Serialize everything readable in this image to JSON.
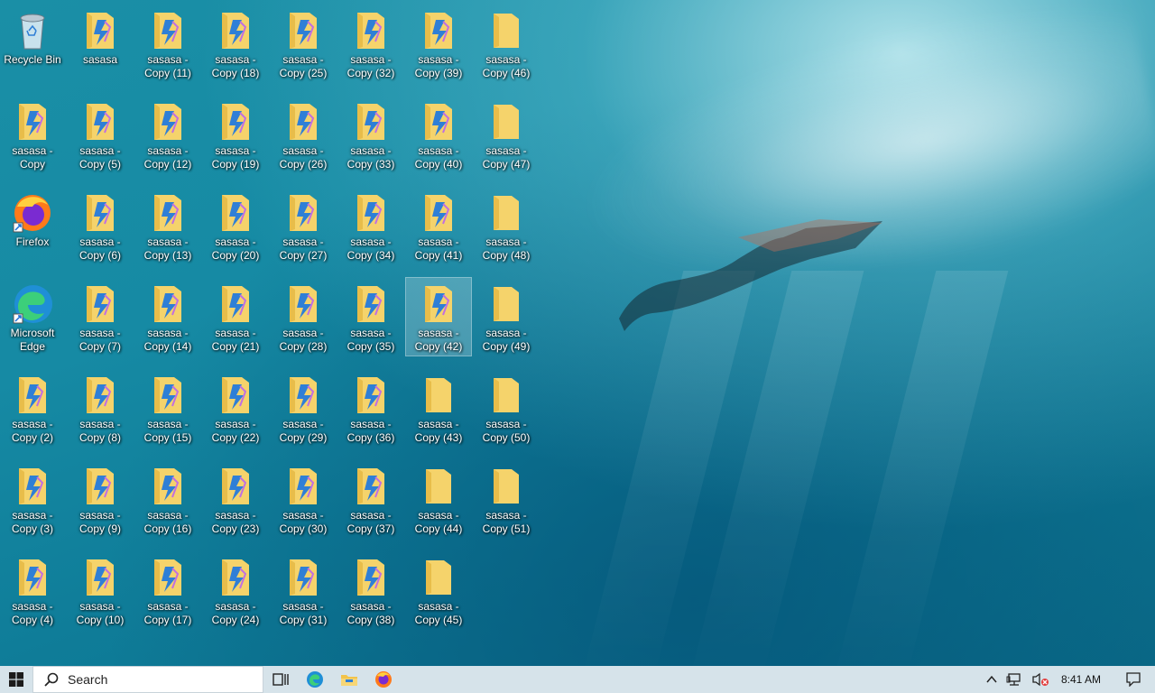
{
  "desktop": {
    "columns": [
      [
        {
          "label": "Recycle Bin",
          "icon": "recycle-bin-icon"
        },
        {
          "label": "sasasa -\nCopy",
          "icon": "folder-app-icon"
        },
        {
          "label": "Firefox",
          "icon": "firefox-icon"
        },
        {
          "label": "Microsoft\nEdge",
          "icon": "edge-icon"
        },
        {
          "label": "sasasa -\nCopy (2)",
          "icon": "folder-app-icon"
        },
        {
          "label": "sasasa -\nCopy (3)",
          "icon": "folder-app-icon"
        },
        {
          "label": "sasasa -\nCopy (4)",
          "icon": "folder-app-icon"
        }
      ],
      [
        {
          "label": "sasasa",
          "icon": "folder-app-icon"
        },
        {
          "label": "sasasa -\nCopy (5)",
          "icon": "folder-app-icon"
        },
        {
          "label": "sasasa -\nCopy (6)",
          "icon": "folder-app-icon"
        },
        {
          "label": "sasasa -\nCopy (7)",
          "icon": "folder-app-icon"
        },
        {
          "label": "sasasa -\nCopy (8)",
          "icon": "folder-app-icon"
        },
        {
          "label": "sasasa -\nCopy (9)",
          "icon": "folder-app-icon"
        },
        {
          "label": "sasasa -\nCopy (10)",
          "icon": "folder-app-icon"
        }
      ],
      [
        {
          "label": "sasasa -\nCopy (11)",
          "icon": "folder-app-icon"
        },
        {
          "label": "sasasa -\nCopy (12)",
          "icon": "folder-app-icon"
        },
        {
          "label": "sasasa -\nCopy (13)",
          "icon": "folder-app-icon"
        },
        {
          "label": "sasasa -\nCopy (14)",
          "icon": "folder-app-icon"
        },
        {
          "label": "sasasa -\nCopy (15)",
          "icon": "folder-app-icon"
        },
        {
          "label": "sasasa -\nCopy (16)",
          "icon": "folder-app-icon"
        },
        {
          "label": "sasasa -\nCopy (17)",
          "icon": "folder-app-icon"
        }
      ],
      [
        {
          "label": "sasasa -\nCopy (18)",
          "icon": "folder-app-icon"
        },
        {
          "label": "sasasa -\nCopy (19)",
          "icon": "folder-app-icon"
        },
        {
          "label": "sasasa -\nCopy (20)",
          "icon": "folder-app-icon"
        },
        {
          "label": "sasasa -\nCopy (21)",
          "icon": "folder-app-icon"
        },
        {
          "label": "sasasa -\nCopy (22)",
          "icon": "folder-app-icon"
        },
        {
          "label": "sasasa -\nCopy (23)",
          "icon": "folder-app-icon"
        },
        {
          "label": "sasasa -\nCopy (24)",
          "icon": "folder-app-icon"
        }
      ],
      [
        {
          "label": "sasasa -\nCopy (25)",
          "icon": "folder-app-icon"
        },
        {
          "label": "sasasa -\nCopy (26)",
          "icon": "folder-app-icon"
        },
        {
          "label": "sasasa -\nCopy (27)",
          "icon": "folder-app-icon"
        },
        {
          "label": "sasasa -\nCopy (28)",
          "icon": "folder-app-icon"
        },
        {
          "label": "sasasa -\nCopy (29)",
          "icon": "folder-app-icon"
        },
        {
          "label": "sasasa -\nCopy (30)",
          "icon": "folder-app-icon"
        },
        {
          "label": "sasasa -\nCopy (31)",
          "icon": "folder-app-icon"
        }
      ],
      [
        {
          "label": "sasasa -\nCopy (32)",
          "icon": "folder-app-icon"
        },
        {
          "label": "sasasa -\nCopy (33)",
          "icon": "folder-app-icon"
        },
        {
          "label": "sasasa -\nCopy (34)",
          "icon": "folder-app-icon"
        },
        {
          "label": "sasasa -\nCopy (35)",
          "icon": "folder-app-icon"
        },
        {
          "label": "sasasa -\nCopy (36)",
          "icon": "folder-app-icon"
        },
        {
          "label": "sasasa -\nCopy (37)",
          "icon": "folder-app-icon"
        },
        {
          "label": "sasasa -\nCopy (38)",
          "icon": "folder-app-icon"
        }
      ],
      [
        {
          "label": "sasasa -\nCopy (39)",
          "icon": "folder-app-icon"
        },
        {
          "label": "sasasa -\nCopy (40)",
          "icon": "folder-app-icon"
        },
        {
          "label": "sasasa -\nCopy (41)",
          "icon": "folder-app-icon"
        },
        {
          "label": "sasasa -\nCopy (42)",
          "icon": "folder-app-icon",
          "selected": true
        },
        {
          "label": "sasasa -\nCopy (43)",
          "icon": "folder-icon"
        },
        {
          "label": "sasasa -\nCopy (44)",
          "icon": "folder-icon"
        },
        {
          "label": "sasasa -\nCopy (45)",
          "icon": "folder-icon"
        }
      ],
      [
        {
          "label": "sasasa -\nCopy (46)",
          "icon": "folder-icon"
        },
        {
          "label": "sasasa -\nCopy (47)",
          "icon": "folder-icon"
        },
        {
          "label": "sasasa -\nCopy (48)",
          "icon": "folder-icon"
        },
        {
          "label": "sasasa -\nCopy (49)",
          "icon": "folder-icon"
        },
        {
          "label": "sasasa -\nCopy (50)",
          "icon": "folder-icon"
        },
        {
          "label": "sasasa -\nCopy (51)",
          "icon": "folder-icon"
        }
      ]
    ]
  },
  "taskbar": {
    "start_icon": "windows-logo-icon",
    "search_placeholder": "Search",
    "apps": [
      {
        "name": "task-view-icon"
      },
      {
        "name": "edge-icon"
      },
      {
        "name": "file-explorer-icon"
      },
      {
        "name": "firefox-icon"
      }
    ],
    "tray": {
      "chevron": "chevron-up-icon",
      "network": "network-icon",
      "volume": "volume-muted-icon",
      "time": "8:41 AM",
      "notifications": "notification-icon"
    },
    "background": "#d6e3ea"
  },
  "colors": {
    "folder": "#f5d36b",
    "app_accent": "#2f7fd6",
    "wallpaper": "#168aa4"
  }
}
